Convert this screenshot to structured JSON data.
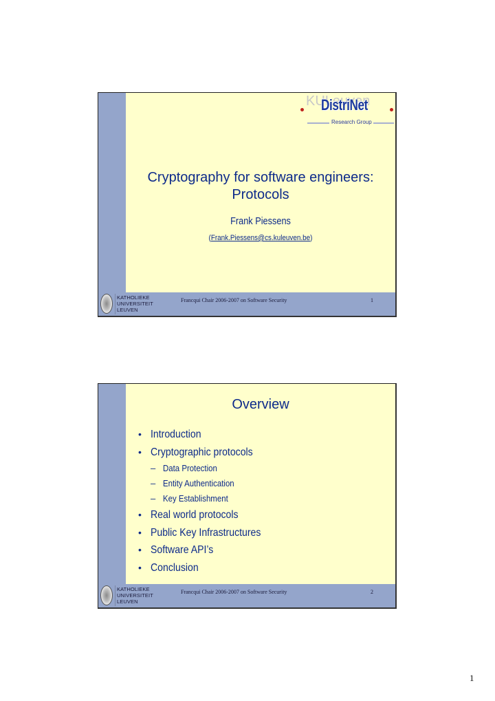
{
  "slides": [
    {
      "logo": {
        "watermark": "KULeuven",
        "brand": "DistriNet",
        "subtitle": "Research Group",
        "dot_color": "#c0221c",
        "brand_color": "#1c3a9c"
      },
      "title_line1": "Cryptography for software engineers:",
      "title_line2": "Protocols",
      "author": "Frank Piessens",
      "email_open": "(",
      "email": "Frank.Piessens@cs.kuleuven.be",
      "email_close": ")",
      "footer": {
        "university": [
          "KATHOLIEKE",
          "UNIVERSITEIT",
          "LEUVEN"
        ],
        "chair": "Francqui Chair 2006-2007 on Software Security",
        "number": "1"
      }
    },
    {
      "title": "Overview",
      "items": [
        {
          "level": 1,
          "text": "Introduction"
        },
        {
          "level": 1,
          "text": "Cryptographic protocols"
        },
        {
          "level": 2,
          "text": "Data Protection"
        },
        {
          "level": 2,
          "text": "Entity Authentication"
        },
        {
          "level": 2,
          "text": "Key Establishment"
        },
        {
          "level": 1,
          "text": "Real world protocols"
        },
        {
          "level": 1,
          "text": "Public Key Infrastructures"
        },
        {
          "level": 1,
          "text": "Software API’s"
        },
        {
          "level": 1,
          "text": "Conclusion"
        }
      ],
      "footer": {
        "university": [
          "KATHOLIEKE",
          "UNIVERSITEIT",
          "LEUVEN"
        ],
        "chair": "Francqui Chair 2006-2007 on Software Security",
        "number": "2"
      }
    }
  ],
  "page_number": "1",
  "colors": {
    "slide_background": "#ffffcc",
    "sidebar": "#94a5cb",
    "text_navy": "#0d2a8a"
  }
}
